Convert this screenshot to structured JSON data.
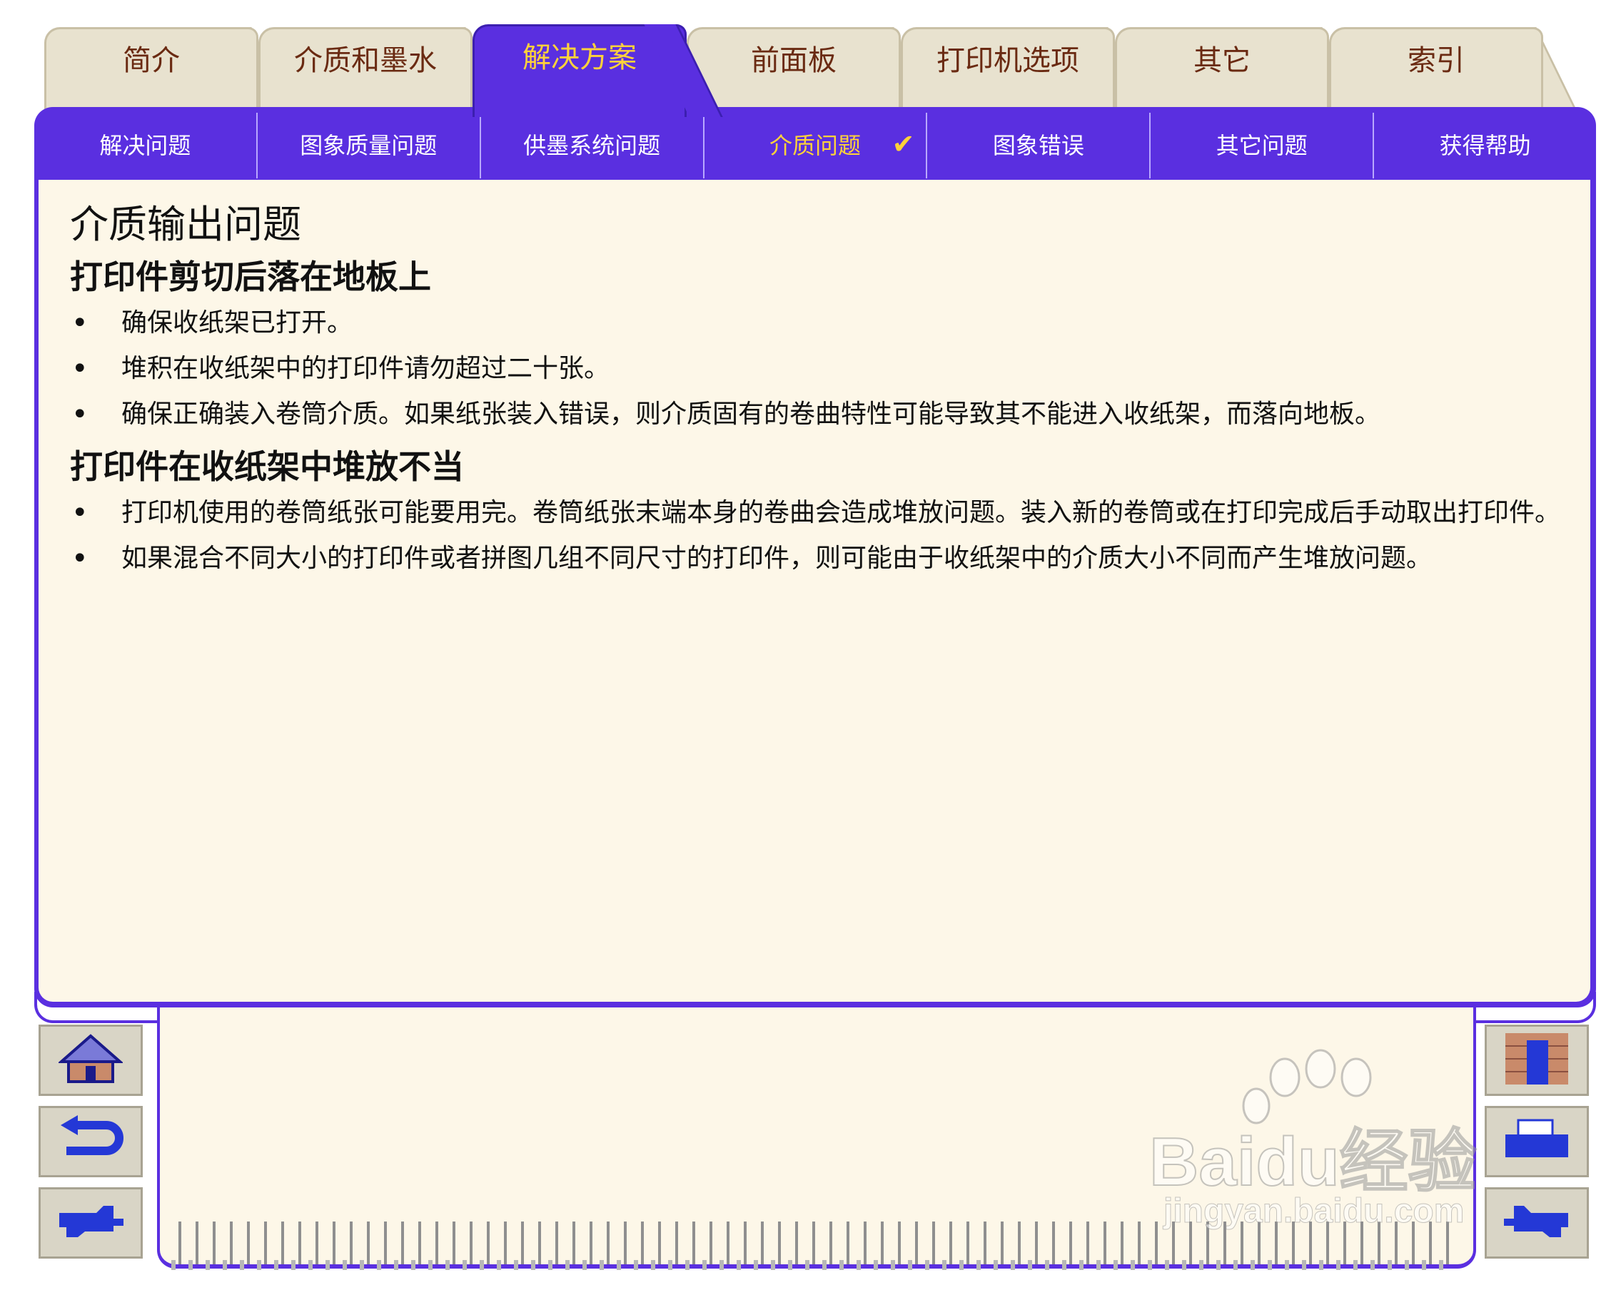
{
  "top_tabs": [
    {
      "label": "简介",
      "active": false
    },
    {
      "label": "介质和墨水",
      "active": false
    },
    {
      "label": "解决方案",
      "active": true
    },
    {
      "label": "前面板",
      "active": false
    },
    {
      "label": "打印机选项",
      "active": false
    },
    {
      "label": "其它",
      "active": false
    },
    {
      "label": "索引",
      "active": false
    }
  ],
  "sub_tabs": [
    {
      "label": "解决问题"
    },
    {
      "label": "图象质量问题"
    },
    {
      "label": "供墨系统问题"
    },
    {
      "label": "介质问题",
      "active": true,
      "check": "✔"
    },
    {
      "label": "图象错误"
    },
    {
      "label": "其它问题"
    },
    {
      "label": "获得帮助"
    }
  ],
  "page": {
    "title": "介质输出问题",
    "sections": [
      {
        "heading": "打印件剪切后落在地板上",
        "bullets": [
          "确保收纸架已打开。",
          "堆积在收纸架中的打印件请勿超过二十张。",
          "确保正确装入卷筒介质。如果纸张装入错误，则介质固有的卷曲特性可能导致其不能进入收纸架，而落向地板。"
        ]
      },
      {
        "heading": "打印件在收纸架中堆放不当",
        "bullets": [
          "打印机使用的卷筒纸张可能要用完。卷筒纸张末端本身的卷曲会造成堆放问题。装入新的卷筒或在打印完成后手动取出打印件。",
          "如果混合不同大小的打印件或者拼图几组不同尺寸的打印件，则可能由于收纸架中的介质大小不同而产生堆放问题。"
        ]
      }
    ]
  },
  "nav_icons": {
    "left": [
      "home-icon",
      "back-icon",
      "next-page-icon"
    ],
    "right": [
      "brick-wall-icon",
      "printer-icon",
      "previous-page-icon"
    ]
  },
  "watermark": {
    "brand": "Bai",
    "brand2": "du",
    "suffix": "经验",
    "url": "jingyan.baidu.com"
  },
  "colors": {
    "accent": "#5a2fe0",
    "active_text": "#ffd23a",
    "tab_text": "#6a2a12",
    "content_bg": "#fdf7e8"
  }
}
